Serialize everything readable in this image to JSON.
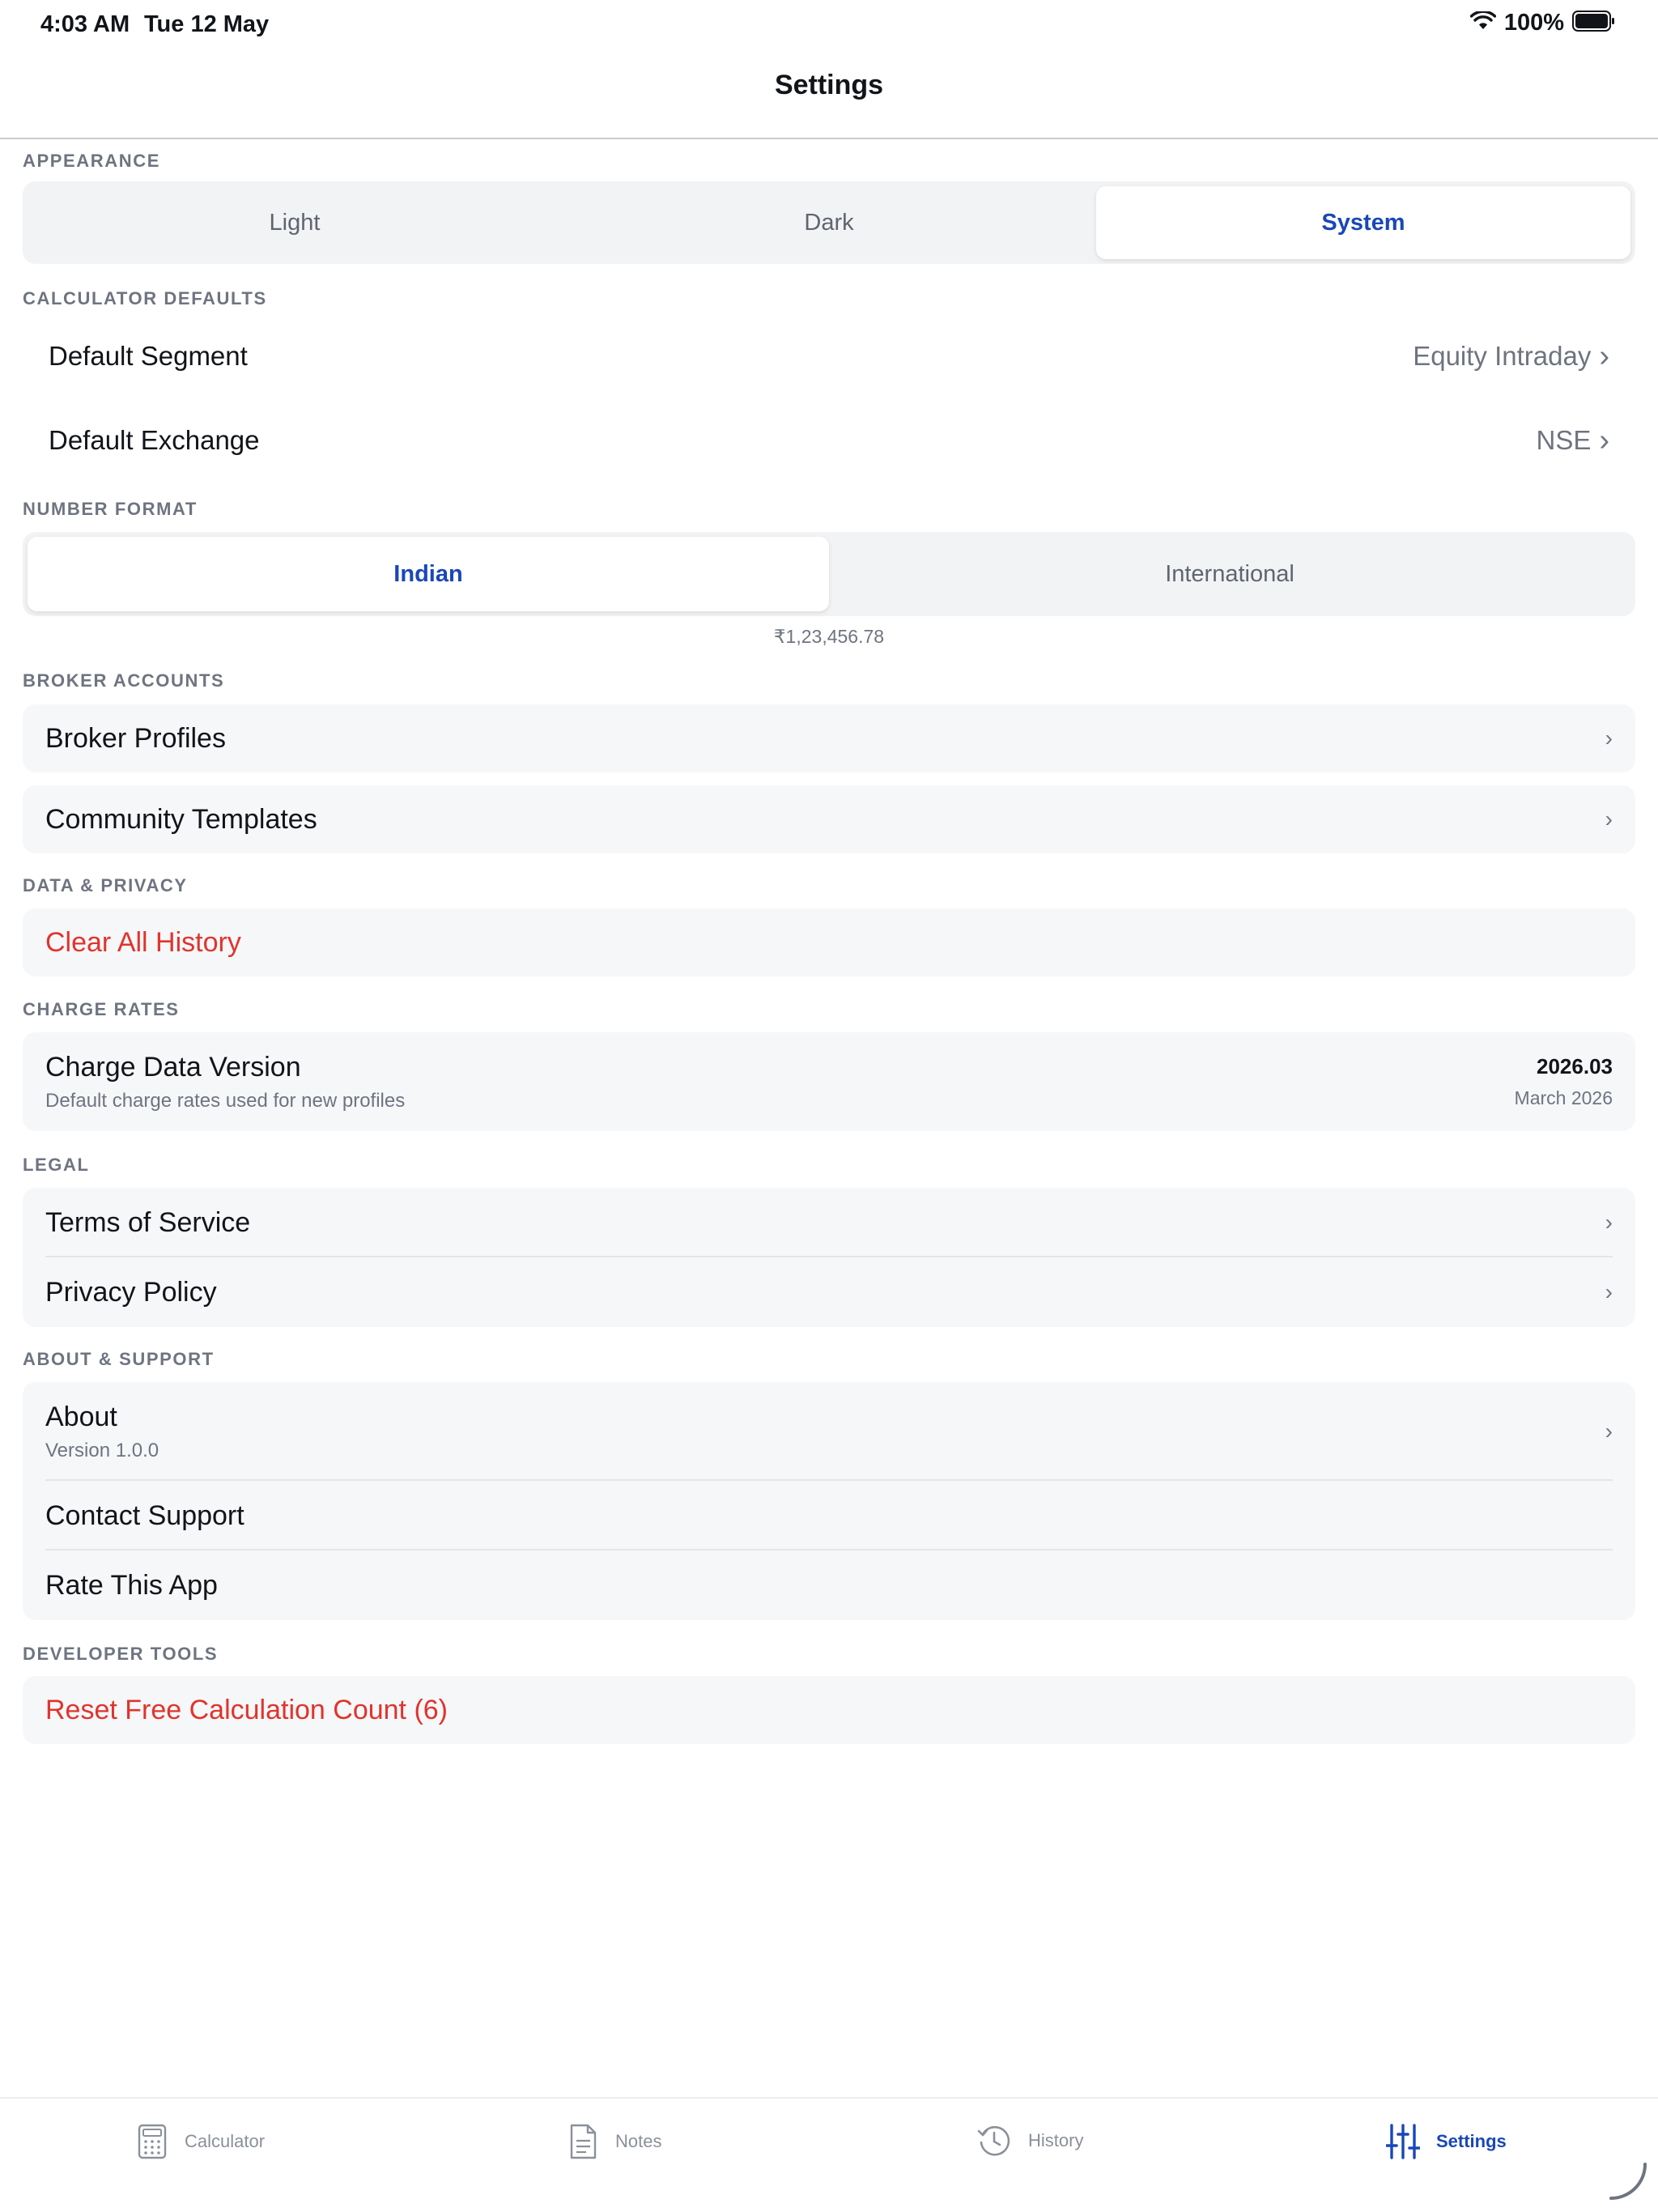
{
  "status": {
    "time": "4:03 AM",
    "date": "Tue 12 May",
    "battery": "100%"
  },
  "nav": {
    "title": "Settings"
  },
  "appearance": {
    "header": "APPEARANCE",
    "options": [
      "Light",
      "Dark",
      "System"
    ],
    "selected": "System"
  },
  "calculator_defaults": {
    "header": "CALCULATOR DEFAULTS",
    "segment": {
      "label": "Default Segment",
      "value": "Equity Intraday"
    },
    "exchange": {
      "label": "Default Exchange",
      "value": "NSE"
    }
  },
  "number_format": {
    "header": "NUMBER FORMAT",
    "options": [
      "Indian",
      "International"
    ],
    "selected": "Indian",
    "example": "₹1,23,456.78"
  },
  "broker_accounts": {
    "header": "BROKER ACCOUNTS",
    "broker_profiles": "Broker Profiles",
    "community_templates": "Community Templates"
  },
  "data_privacy": {
    "header": "DATA & PRIVACY",
    "clear_history": "Clear All History"
  },
  "charge_rates": {
    "header": "CHARGE RATES",
    "label": "Charge Data Version",
    "sub": "Default charge rates used for new profiles",
    "version": "2026.03",
    "version_date": "March 2026"
  },
  "legal": {
    "header": "LEGAL",
    "terms": "Terms of Service",
    "privacy": "Privacy Policy"
  },
  "about_support": {
    "header": "ABOUT & SUPPORT",
    "about": "About",
    "version": "Version 1.0.0",
    "contact": "Contact Support",
    "rate": "Rate This App"
  },
  "developer_tools": {
    "header": "DEVELOPER TOOLS",
    "reset": "Reset Free Calculation Count (6)"
  },
  "tabs": {
    "calculator": "Calculator",
    "notes": "Notes",
    "history": "History",
    "settings": "Settings",
    "active": "Settings"
  },
  "chevron": "›",
  "colors": {
    "accent": "#1a47b8",
    "danger": "#e0342c",
    "secondary_text": "#6e7480",
    "card_bg": "#f6f7f9"
  }
}
